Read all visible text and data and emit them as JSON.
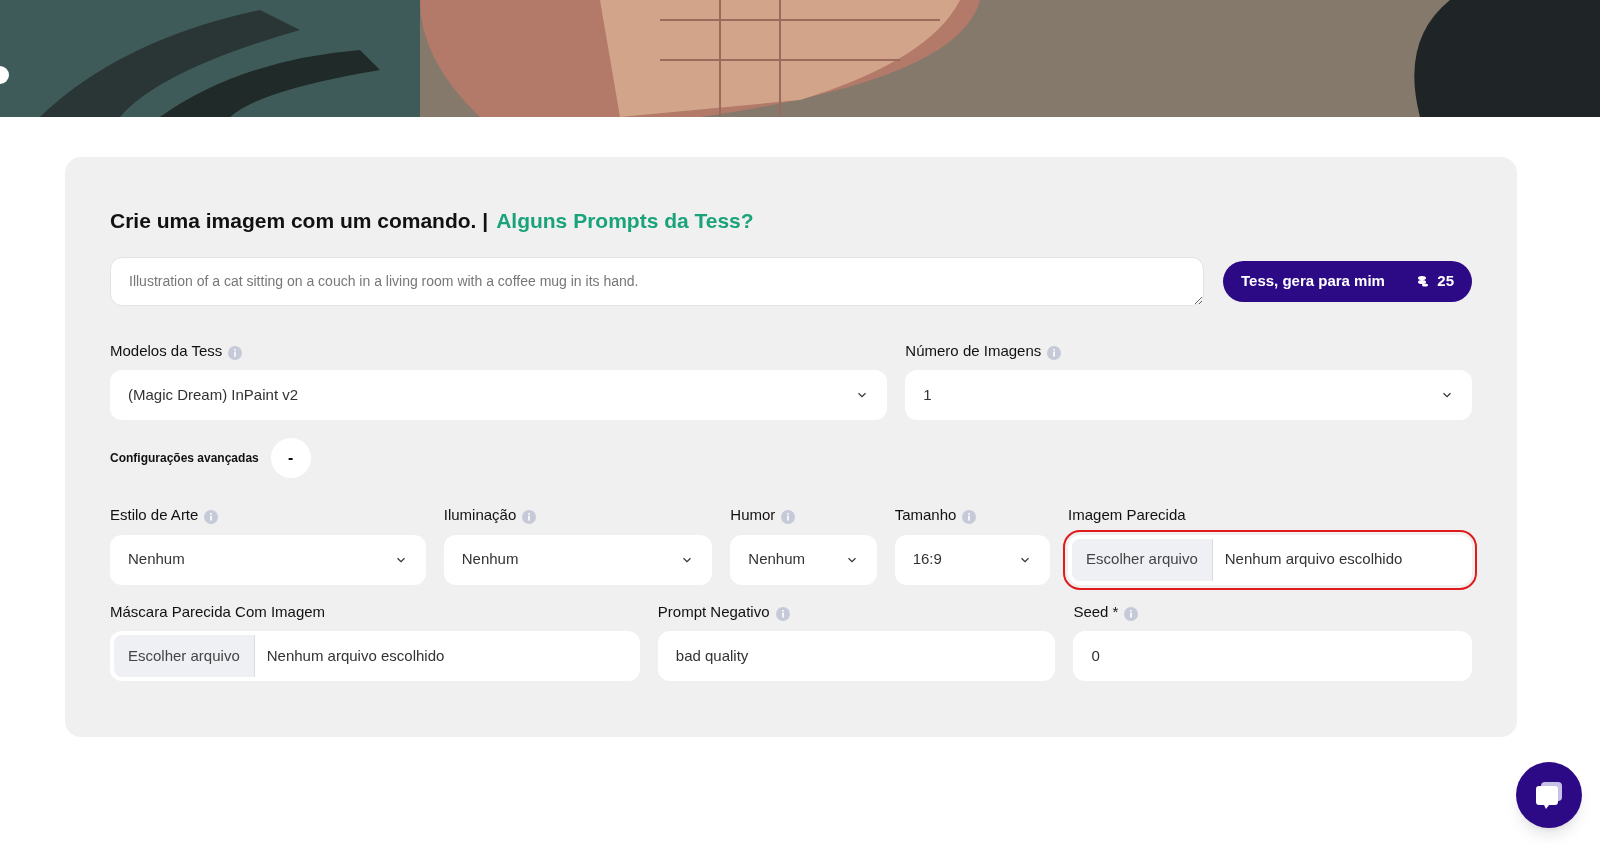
{
  "heading": {
    "title": "Crie uma imagem com um comando. |",
    "link": "Alguns Prompts da Tess?"
  },
  "prompt": {
    "placeholder": "Illustration of a cat sitting on a couch in a living room with a coffee mug in its hand."
  },
  "generate_button": {
    "label": "Tess, gera para mim",
    "credits": "25"
  },
  "main_fields": [
    {
      "kind": "select",
      "label": "Modelos da Tess",
      "info": true,
      "value": "(Magic Dream) InPaint v2",
      "highlighted": false
    },
    {
      "kind": "select",
      "label": "Número de Imagens",
      "info": true,
      "value": "1",
      "highlighted": false
    }
  ],
  "advanced": {
    "label": "Configurações avançadas",
    "toggle": "-"
  },
  "advanced_fields": [
    {
      "kind": "select",
      "label": "Estilo de Arte",
      "info": true,
      "value": "Nenhum",
      "highlighted": false
    },
    {
      "kind": "select",
      "label": "Iluminação",
      "info": true,
      "value": "Nenhum",
      "highlighted": false
    },
    {
      "kind": "select",
      "label": "Humor",
      "info": true,
      "value": "Nenhum",
      "highlighted": false
    },
    {
      "kind": "select",
      "label": "Tamanho",
      "info": true,
      "value": "16:9",
      "highlighted": false
    },
    {
      "kind": "file",
      "label": "Imagem Parecida",
      "info": false,
      "button": "Escolher arquivo",
      "value": "Nenhum arquivo escolhido",
      "highlighted": true
    }
  ],
  "extra_fields": [
    {
      "kind": "file",
      "label": "Máscara Parecida Com Imagem",
      "info": false,
      "button": "Escolher arquivo",
      "value": "Nenhum arquivo escolhido",
      "highlighted": false
    },
    {
      "kind": "text",
      "label": "Prompt Negativo",
      "info": true,
      "value": "bad quality",
      "highlighted": false
    },
    {
      "kind": "text",
      "label": "Seed *",
      "info": true,
      "value": "0",
      "highlighted": false
    }
  ]
}
